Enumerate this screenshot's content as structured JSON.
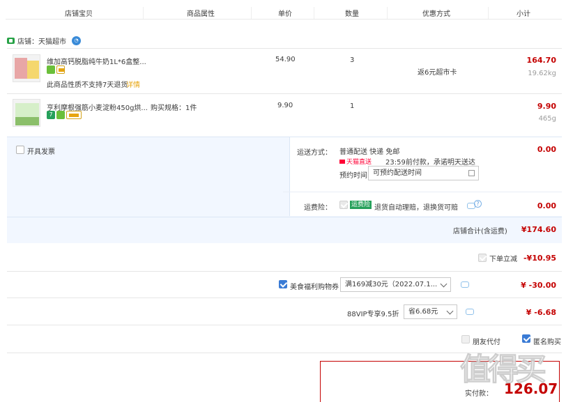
{
  "header": {
    "col_shop_item": "店铺宝贝",
    "col_attributes": "商品属性",
    "col_unit_price": "单价",
    "col_quantity": "数量",
    "col_discount": "优惠方式",
    "col_subtotal": "小计"
  },
  "shop": {
    "label": "店铺：天猫超市"
  },
  "items": [
    {
      "title": "维加高钙脱脂纯牛奶1L*6盒整...",
      "attributes": "",
      "unit_price": "54.90",
      "quantity": "3",
      "discount": "返6元超市卡",
      "subtotal": "164.70",
      "weight": "19.62kg",
      "notice": "此商品性质不支持7天退货",
      "notice_link": "详情"
    },
    {
      "title": "亨利摩根强筋小麦淀粉450g烘...",
      "attributes": "购买规格：1件",
      "unit_price": "9.90",
      "quantity": "1",
      "discount": "",
      "subtotal": "9.90",
      "weight": "465g"
    }
  ],
  "invoice": {
    "label": "开具发票"
  },
  "shipping": {
    "label": "运送方式：",
    "method": "普通配送 快递 免邮",
    "tmall_direct": "天猫直送",
    "promise": "23:59前付款，承诺明天送达",
    "time_label": "预约时间",
    "time_placeholder": "可预约配送时间",
    "fee": "0.00"
  },
  "insurance": {
    "label": "运费险：",
    "tag": "运费险",
    "desc": "退货自动理赔，退换货可赔",
    "fee": "0.00"
  },
  "shop_total": {
    "label": "店铺合计(含运费)",
    "value": "¥174.60"
  },
  "discounts": {
    "instant": {
      "label": "下单立减",
      "value": "-¥10.95"
    },
    "coupon": {
      "label": "美食福利购物券",
      "selected": "满169减30元（2022.07.1...",
      "value": "¥ -30.00"
    },
    "vip": {
      "label": "88VIP专享9.5折",
      "selected": "省6.68元",
      "value": "¥ -6.68"
    }
  },
  "options": {
    "friend_pay": "朋友代付",
    "anonymous": "匿名购买"
  },
  "footer": {
    "pay_label": "实付款：",
    "pay_value": "126.07",
    "watermark": "值得买"
  },
  "colors": {
    "accent": "#c40000",
    "brand_blue": "#3a7bd5",
    "panel_bg": "#f2f7ff"
  }
}
